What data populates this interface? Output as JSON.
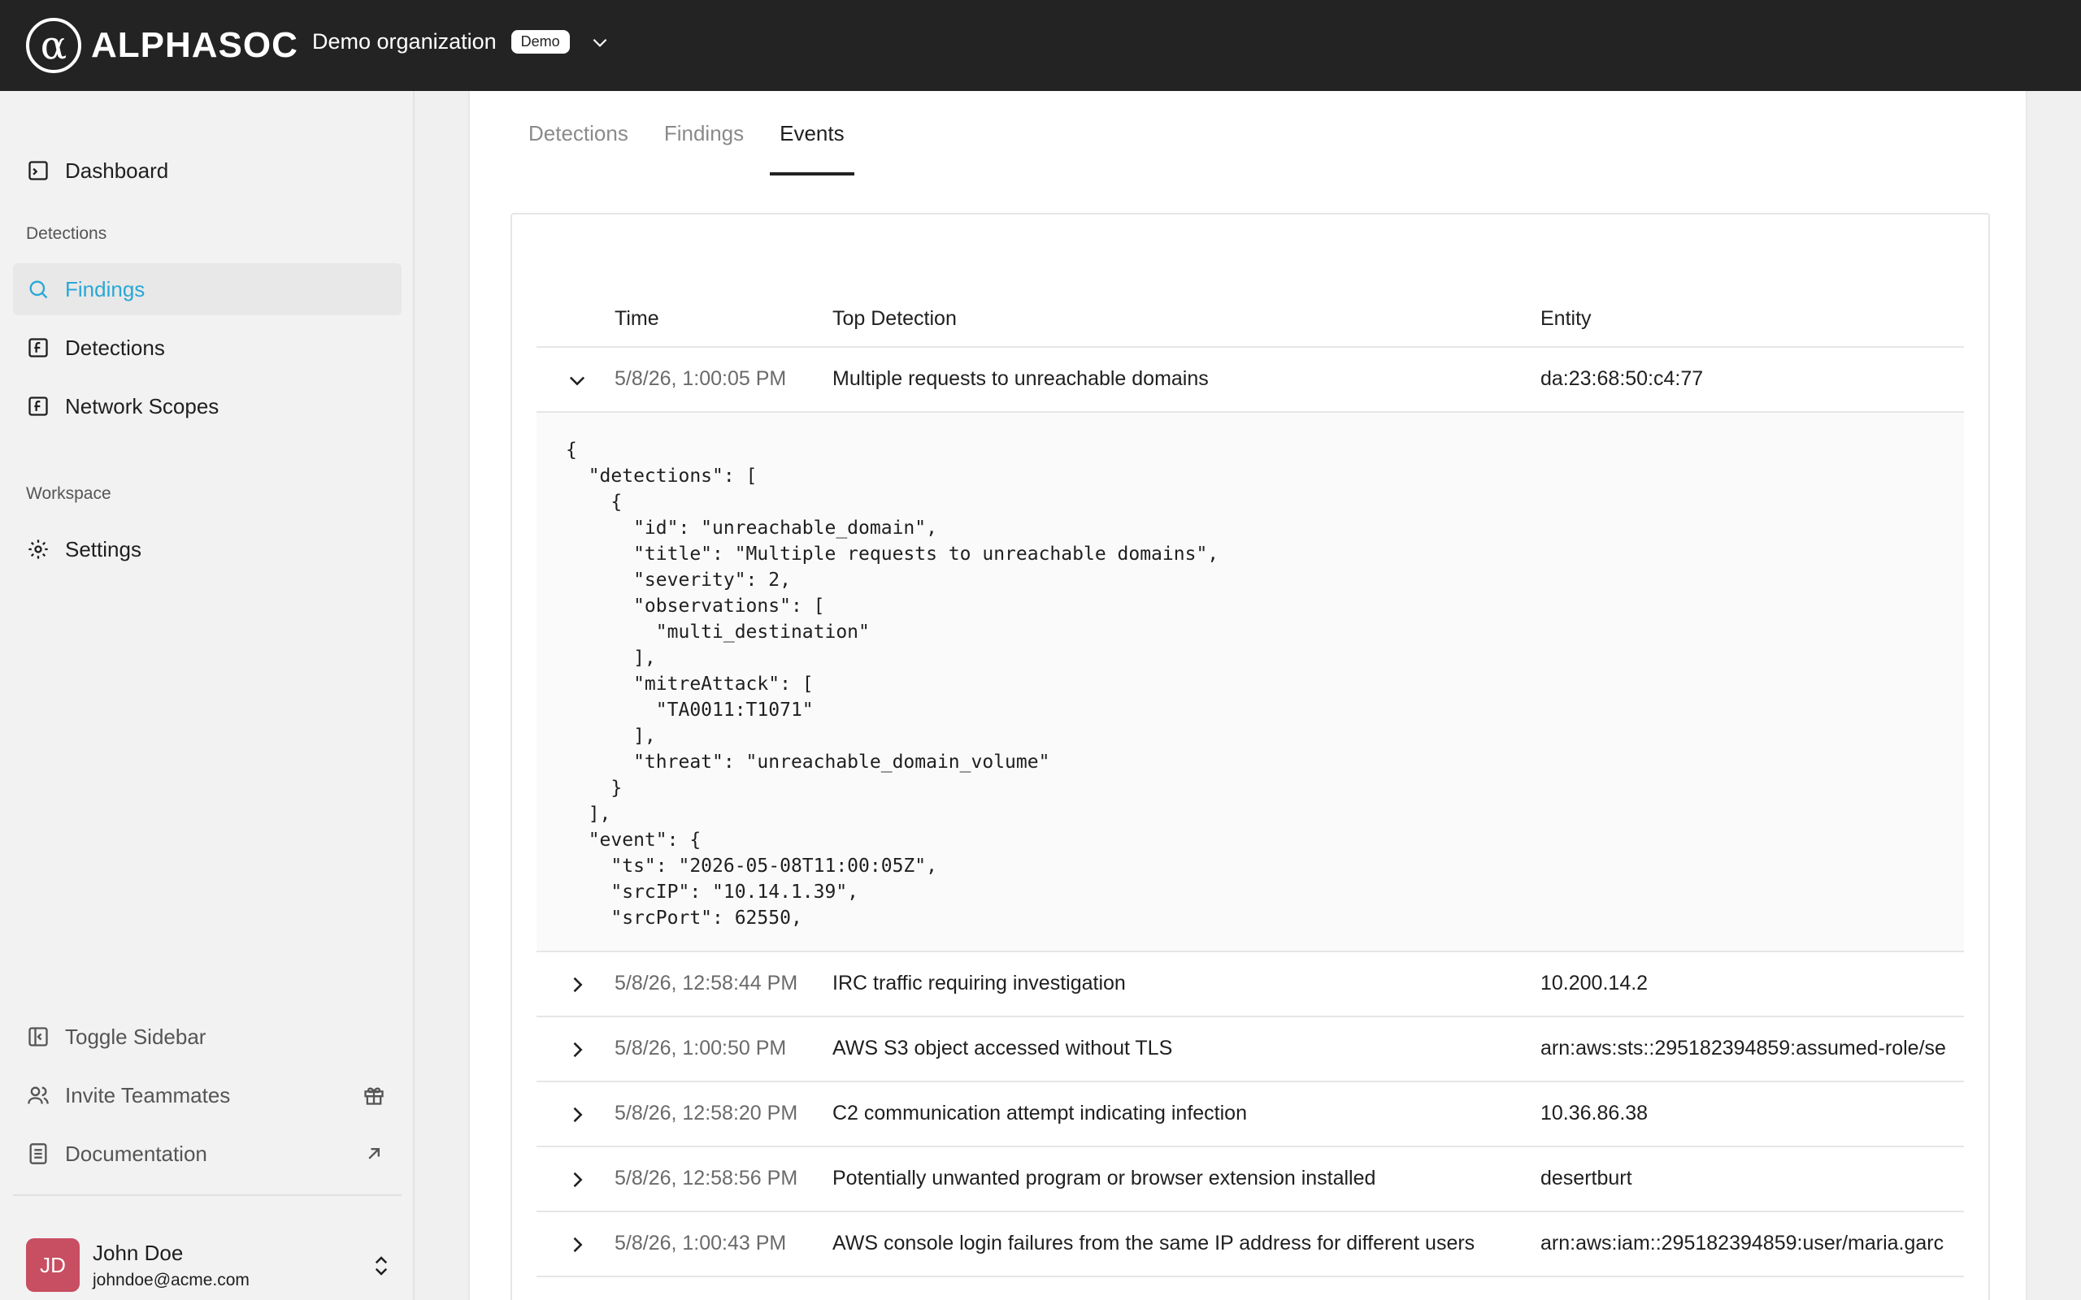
{
  "header": {
    "logo_mark": "α",
    "logo_text": "ALPHASOC",
    "org_name": "Demo organization",
    "org_badge": "Demo"
  },
  "sidebar": {
    "dashboard": "Dashboard",
    "section_detections": "Detections",
    "findings": "Findings",
    "detections": "Detections",
    "network_scopes": "Network Scopes",
    "section_workspace": "Workspace",
    "settings": "Settings",
    "toggle_sidebar": "Toggle Sidebar",
    "invite_teammates": "Invite Teammates",
    "documentation": "Documentation",
    "user": {
      "initials": "JD",
      "name": "John Doe",
      "email": "johndoe@acme.com"
    }
  },
  "tabs": [
    "Detections",
    "Findings",
    "Events"
  ],
  "active_tab": "Events",
  "table": {
    "columns": [
      "Time",
      "Top Detection",
      "Entity"
    ],
    "expanded_row": {
      "time": "5/8/26, 1:00:05 PM",
      "detection": "Multiple requests to unreachable domains",
      "entity": "da:23:68:50:c4:77",
      "json": "{\n  \"detections\": [\n    {\n      \"id\": \"unreachable_domain\",\n      \"title\": \"Multiple requests to unreachable domains\",\n      \"severity\": 2,\n      \"observations\": [\n        \"multi_destination\"\n      ],\n      \"mitreAttack\": [\n        \"TA0011:T1071\"\n      ],\n      \"threat\": \"unreachable_domain_volume\"\n    }\n  ],\n  \"event\": {\n    \"ts\": \"2026-05-08T11:00:05Z\",\n    \"srcIP\": \"10.14.1.39\",\n    \"srcPort\": 62550,"
    },
    "rows": [
      {
        "time": "5/8/26, 12:58:44 PM",
        "detection": "IRC traffic requiring investigation",
        "entity": "10.200.14.2"
      },
      {
        "time": "5/8/26, 1:00:50 PM",
        "detection": "AWS S3 object accessed without TLS",
        "entity": "arn:aws:sts::295182394859:assumed-role/se"
      },
      {
        "time": "5/8/26, 12:58:20 PM",
        "detection": "C2 communication attempt indicating infection",
        "entity": "10.36.86.38"
      },
      {
        "time": "5/8/26, 12:58:56 PM",
        "detection": "Potentially unwanted program or browser extension installed",
        "entity": "desertburt"
      },
      {
        "time": "5/8/26, 1:00:43 PM",
        "detection": "AWS console login failures from the same IP address for different users",
        "entity": "arn:aws:iam::295182394859:user/maria.garc"
      }
    ]
  }
}
